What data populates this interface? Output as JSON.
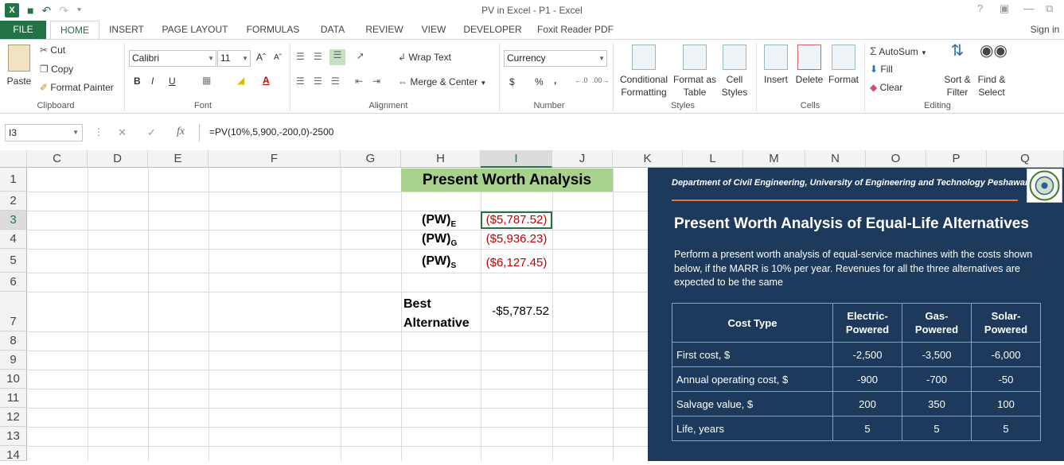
{
  "window": {
    "title": "PV in Excel - P1 - Excel"
  },
  "qat": {
    "app_icon": "X",
    "save": "💾",
    "undo": "↶",
    "redo": "↷",
    "customize": "⯆"
  },
  "tabs": [
    "FILE",
    "HOME",
    "INSERT",
    "PAGE LAYOUT",
    "FORMULAS",
    "DATA",
    "REVIEW",
    "VIEW",
    "DEVELOPER",
    "Foxit Reader PDF"
  ],
  "signin": "Sign in",
  "clipboard": {
    "paste": "Paste",
    "cut": "Cut",
    "copy": "Copy",
    "format_painter": "Format Painter",
    "label": "Clipboard"
  },
  "font": {
    "name": "Calibri",
    "size": "11",
    "bold": "B",
    "italic": "I",
    "underline": "U",
    "label": "Font"
  },
  "alignment": {
    "wrap_text": "Wrap Text",
    "merge_center": "Merge & Center",
    "label": "Alignment"
  },
  "number": {
    "format": "Currency",
    "dollar": "$",
    "percent": "%",
    "comma": ",",
    "label": "Number"
  },
  "styles": {
    "conditional": [
      "Conditional",
      "Formatting"
    ],
    "format_table": [
      "Format as",
      "Table"
    ],
    "cell_styles": [
      "Cell",
      "Styles"
    ],
    "label": "Styles"
  },
  "cells": {
    "insert": "Insert",
    "delete": "Delete",
    "format": "Format",
    "label": "Cells"
  },
  "editing": {
    "autosum": "AutoSum",
    "fill": "Fill",
    "clear": "Clear",
    "sort": [
      "Sort &",
      "Filter"
    ],
    "find": [
      "Find &",
      "Select"
    ],
    "label": "Editing"
  },
  "formula_bar": {
    "name_box": "I3",
    "cancel": "✕",
    "enter": "✓",
    "fx": "fx",
    "formula": "=PV(10%,5,900,-200,0)-2500"
  },
  "columns": [
    "C",
    "D",
    "E",
    "F",
    "G",
    "H",
    "I",
    "J",
    "K",
    "L",
    "M",
    "N",
    "O",
    "P",
    "Q"
  ],
  "rows": [
    "1",
    "2",
    "3",
    "4",
    "5",
    "6",
    "7",
    "8",
    "9",
    "10",
    "11",
    "12",
    "13",
    "14"
  ],
  "sheet": {
    "title": "Present Worth Analysis",
    "pw_e": {
      "label": "(PW)",
      "sub": "E",
      "value": "($5,787.52)"
    },
    "pw_g": {
      "label": "(PW)",
      "sub": "G",
      "value": "($5,936.23)"
    },
    "pw_s": {
      "label": "(PW)",
      "sub": "S",
      "value": "($6,127.45)"
    },
    "best_line1": "Best",
    "best_line2": "Alternative",
    "best_value": "-$5,787.52"
  },
  "overlay": {
    "department": "Department of Civil Engineering, University of Engineering and Technology Peshawar",
    "heading": "Present Worth Analysis of Equal-Life Alternatives",
    "description": "Perform a present worth analysis of equal-service machines with the costs shown below, if the MARR is 10% per year. Revenues for all the three alternatives are expected to be the same",
    "table": {
      "headers": [
        "Cost Type",
        "Electric-\nPowered",
        "Gas-\nPowered",
        "Solar-\nPowered"
      ],
      "rows": [
        [
          "First cost, $",
          "-2,500",
          "-3,500",
          "-6,000"
        ],
        [
          "Annual operating cost, $",
          "-900",
          "-700",
          "-50"
        ],
        [
          "Salvage value, $",
          "200",
          "350",
          "100"
        ],
        [
          "Life, years",
          "5",
          "5",
          "5"
        ]
      ]
    }
  },
  "colors": {
    "excel_green": "#217346",
    "negative_red": "#c00000",
    "title_fill": "#a9d18e",
    "overlay_bg": "#1d3a5c",
    "accent_orange": "#e07a2e"
  }
}
